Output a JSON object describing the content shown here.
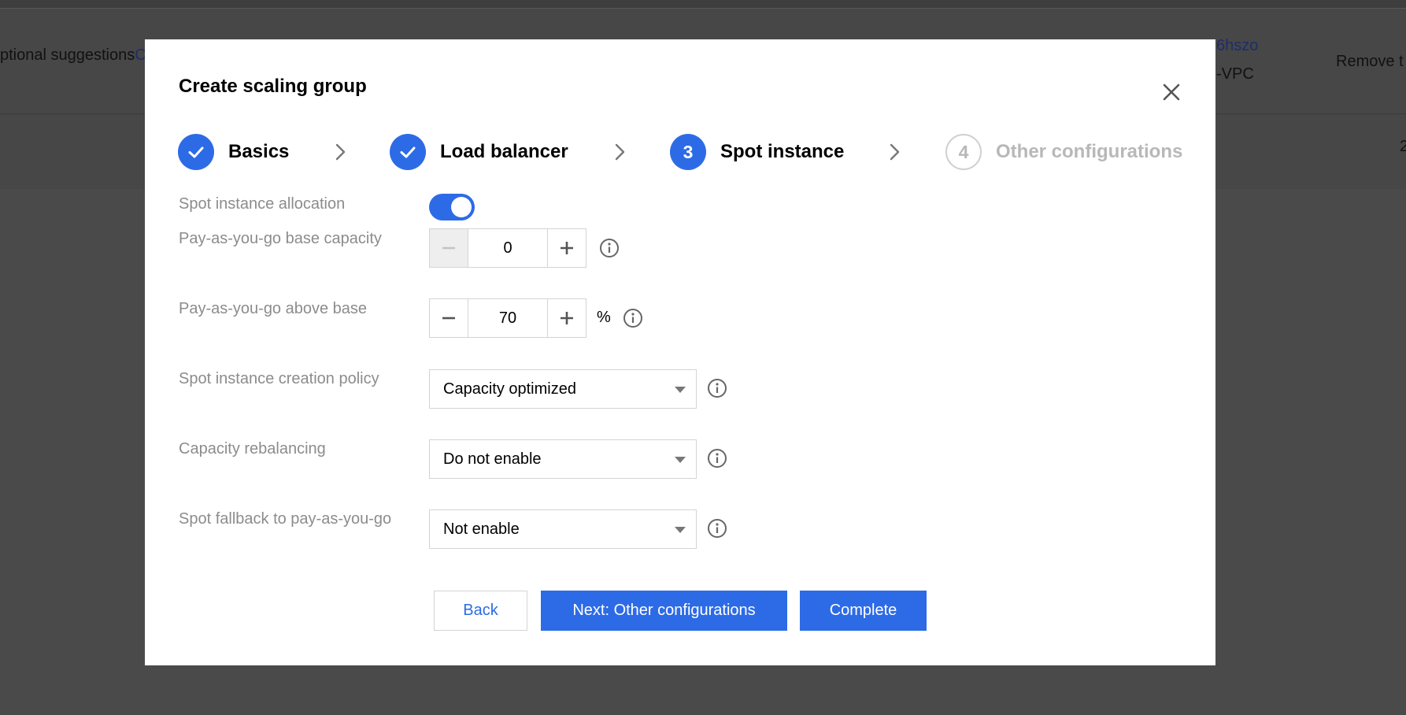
{
  "background": {
    "row_text_left": "ptional suggestions",
    "row_link_left": "C",
    "row_link_right": "6hszo",
    "row_text_vpc": "-VPC",
    "row_text_remove": "Remove t",
    "row2_text_right": "2"
  },
  "modal": {
    "title": "Create scaling group",
    "steps": [
      {
        "number": "",
        "label": "Basics",
        "state": "done"
      },
      {
        "number": "",
        "label": "Load balancer",
        "state": "done"
      },
      {
        "number": "3",
        "label": "Spot instance",
        "state": "active"
      },
      {
        "number": "4",
        "label": "Other configurations",
        "state": "pending"
      }
    ],
    "form": {
      "spot_allocation": {
        "label": "Spot instance allocation",
        "enabled": true
      },
      "base_capacity": {
        "label": "Pay-as-you-go base capacity",
        "value": "0"
      },
      "above_base": {
        "label": "Pay-as-you-go above base",
        "value": "70",
        "unit": "%"
      },
      "creation_policy": {
        "label": "Spot instance creation policy",
        "value": "Capacity optimized"
      },
      "rebalancing": {
        "label": "Capacity rebalancing",
        "value": "Do not enable"
      },
      "fallback": {
        "label": "Spot fallback to pay-as-you-go",
        "value": "Not enable"
      }
    },
    "buttons": {
      "back": "Back",
      "next": "Next: Other configurations",
      "complete": "Complete"
    }
  },
  "colors": {
    "accent": "#2d6be6",
    "label_gray": "#8c8c8c",
    "pending_gray": "#b8b8b8",
    "overlay": "#4a4a4a"
  },
  "icons": [
    "check-icon",
    "chevron-right-icon",
    "close-icon",
    "minus-icon",
    "plus-icon",
    "info-icon",
    "caret-down-icon"
  ]
}
